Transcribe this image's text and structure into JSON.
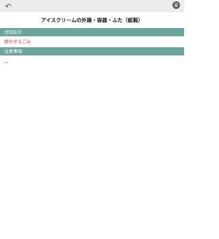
{
  "header": {
    "back_icon": "undo-arrow-icon",
    "menu_icon": "hamburger-menu-icon"
  },
  "page": {
    "title": "アイスクリームの外箱・容器・ふた（紙製）"
  },
  "sections": [
    {
      "label": "分別区分",
      "value": "燃やせるごみ",
      "value_color": "#e53b2c"
    },
    {
      "label": "注意事項",
      "value": "－"
    }
  ],
  "colors": {
    "header_bg": "#ececec",
    "section_bg": "#6aa79a",
    "accent_red": "#e53b2c"
  }
}
